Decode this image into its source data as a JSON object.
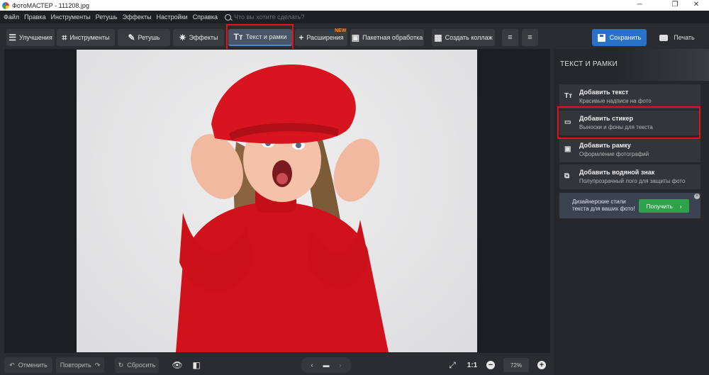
{
  "window": {
    "title": "ФотоМАСТЕР - 111208.jpg",
    "minimize_glyph": "─",
    "maximize_glyph": "❐",
    "close_glyph": "✕"
  },
  "menu": {
    "items": [
      "Файл",
      "Правка",
      "Инструменты",
      "Ретушь",
      "Эффекты",
      "Настройки",
      "Справка"
    ],
    "search_placeholder": "Что вы хотите сделать?"
  },
  "toolbar": {
    "tabs": [
      {
        "label": "Улучшения",
        "icon": "sliders-icon",
        "glyph": "☰"
      },
      {
        "label": "Инструменты",
        "icon": "crop-icon",
        "glyph": "⌗"
      },
      {
        "label": "Ретушь",
        "icon": "brush-icon",
        "glyph": "✎"
      },
      {
        "label": "Эффекты",
        "icon": "sparkle-icon",
        "glyph": "✷"
      },
      {
        "label": "Текст и рамки",
        "icon": "text-icon",
        "glyph": "Tт"
      },
      {
        "label": "Расширения",
        "icon": "plus-icon",
        "glyph": "+"
      },
      {
        "label": "Пакетная обработка",
        "icon": "image-stack-icon",
        "glyph": "▣"
      },
      {
        "label": "Создать коллаж",
        "icon": "grid-icon",
        "glyph": "▦"
      }
    ],
    "active_tab": "Текст и рамки",
    "new_badge": "NEW",
    "save_label": "Сохранить",
    "print_label": "Печать"
  },
  "bottom": {
    "undo_label": "Отменить",
    "redo_label": "Повторить",
    "reset_label": "Сбросить",
    "ratio_label": "1:1",
    "zoom": "72%"
  },
  "panel": {
    "title": "ТЕКСТ И РАМКИ",
    "options": [
      {
        "title": "Добавить текст",
        "subtitle": "Красивые надписи на фото",
        "icon": "text-icon",
        "glyph": "Tт"
      },
      {
        "title": "Добавить стикер",
        "subtitle": "Выноски и фоны для текста",
        "icon": "speech-bubble-icon",
        "glyph": "💬"
      },
      {
        "title": "Добавить рамку",
        "subtitle": "Оформление фотографий",
        "icon": "frame-icon",
        "glyph": "▣"
      },
      {
        "title": "Добавить водяной знак",
        "subtitle": "Полупрозрачный лого для защиты фото",
        "icon": "watermark-icon",
        "glyph": "⧉"
      }
    ],
    "promo": {
      "line1": "Дизайнерские стили",
      "line2": "текста для ваших фото!",
      "button": "Получить",
      "button_arrow": "›",
      "close_glyph": "×"
    }
  },
  "colors": {
    "accent": "#2a72c8",
    "highlight": "#e0141a",
    "promo_button": "#2ea24a",
    "new_badge": "#ff8c1a"
  }
}
